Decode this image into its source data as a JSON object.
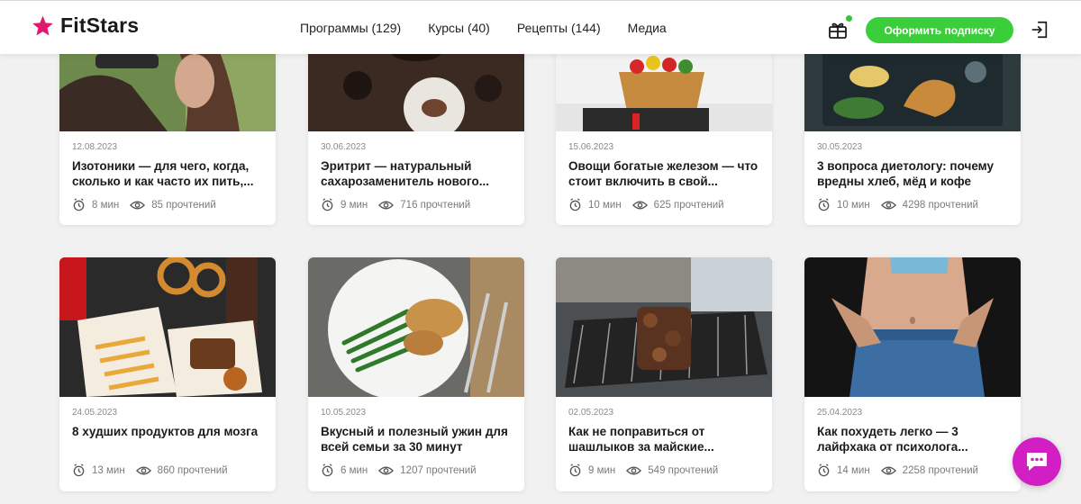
{
  "header": {
    "logo_text": "FitStars",
    "brand_color": "#e2186f",
    "nav": [
      {
        "label": "Программы (129)"
      },
      {
        "label": "Курсы (40)"
      },
      {
        "label": "Рецепты (144)"
      },
      {
        "label": "Медиа"
      }
    ],
    "subscribe_label": "Оформить подписку",
    "icons": {
      "gift": "gift-icon",
      "login": "login-icon"
    }
  },
  "cards": [
    {
      "date": "12.08.2023",
      "title": "Изотоники — для чего, когда, сколько и как часто их пить,...",
      "time": "8 мин",
      "views": "85 прочтений",
      "image": "woman-drinking-bottle"
    },
    {
      "date": "30.06.2023",
      "title": "Эритрит — натуральный сахарозаменитель нового...",
      "time": "9 мин",
      "views": "716 прочтений",
      "image": "coffee-dessert-table"
    },
    {
      "date": "15.06.2023",
      "title": "Овощи богатые железом — что стоит включить в свой...",
      "time": "10 мин",
      "views": "625 прочтений",
      "image": "vegetable-basket"
    },
    {
      "date": "30.05.2023",
      "title": "3 вопроса диетологу: почему вредны хлеб, мёд и кофе",
      "time": "10 мин",
      "views": "4298 прочтений",
      "image": "croissant-tray"
    },
    {
      "date": "24.05.2023",
      "title": "8 худших продуктов для мозга",
      "time": "13 мин",
      "views": "860 прочтений",
      "image": "fast-food-fries"
    },
    {
      "date": "10.05.2023",
      "title": "Вкусный и полезный ужин для всей семьи за 30 минут",
      "time": "6 мин",
      "views": "1207 прочтений",
      "image": "chicken-green-beans"
    },
    {
      "date": "02.05.2023",
      "title": "Как не поправиться от шашлыков за майские...",
      "time": "9 мин",
      "views": "549 прочтений",
      "image": "grill-kebabs"
    },
    {
      "date": "25.04.2023",
      "title": "Как похудеть легко — 3 лайфхака от психолога...",
      "time": "14 мин",
      "views": "2258 прочтений",
      "image": "waist-jeans"
    }
  ],
  "chat": {
    "icon": "chat-icon",
    "color": "#d11fc4"
  }
}
